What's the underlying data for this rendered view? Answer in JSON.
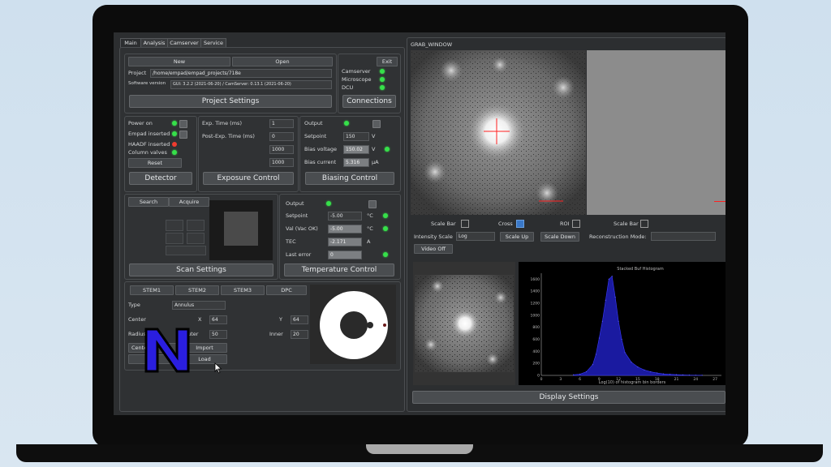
{
  "tabs": [
    "Main",
    "Analysis",
    "Camserver",
    "Service"
  ],
  "project": {
    "new_label": "New",
    "open_label": "Open",
    "project_label": "Project",
    "project_path": "/home/empad/empad_projects/718e",
    "software_label": "Software version",
    "software_value": "GUI: 3.2.2 (2021-06-20) / CamServer: 0.13.1 (2021-06-20)",
    "settings_label": "Project Settings"
  },
  "connections": {
    "exit_label": "Exit",
    "items": [
      "Camserver",
      "Microscope",
      "DCU"
    ],
    "button_label": "Connections"
  },
  "detector": {
    "items": [
      "Power on",
      "Empad inserted",
      "HAADF inserted",
      "Column valves"
    ],
    "reset_label": "Reset",
    "button_label": "Detector"
  },
  "exposure": {
    "exp_time_label": "Exp. Time (ms)",
    "exp_time_value": "1",
    "post_exp_label": "Post-Exp. Time (ms)",
    "post_exp_value": "0",
    "val3": "1000",
    "val4": "1000",
    "button_label": "Exposure Control"
  },
  "biasing": {
    "output_label": "Output",
    "setpoint_label": "Setpoint",
    "setpoint_value": "150",
    "setpoint_unit": "V",
    "voltage_label": "Bias voltage",
    "voltage_value": "150.02",
    "voltage_unit": "V",
    "current_label": "Bias current",
    "current_value": "5.316",
    "current_unit": "μA",
    "button_label": "Biasing Control"
  },
  "scan": {
    "search_label": "Search",
    "acquire_label": "Acquire",
    "button_label": "Scan Settings"
  },
  "temperature": {
    "output_label": "Output",
    "setpoint_label": "Setpoint",
    "setpoint_value": "-5.00",
    "setpoint_unit": "°C",
    "val_label": "Val (Vac OK)",
    "val_value": "-5.00",
    "val_unit": "°C",
    "tec_label": "TEC",
    "tec_value": "-2.171",
    "tec_unit": "A",
    "last_error_label": "Last error",
    "last_error_value": "0",
    "button_label": "Temperature Control"
  },
  "stem": {
    "tabs": [
      "STEM1",
      "STEM2",
      "STEM3",
      "DPC"
    ],
    "type_label": "Type",
    "type_value": "Annulus",
    "center_label": "Center",
    "x_label": "X",
    "x_value": "64",
    "y_label": "Y",
    "y_value": "64",
    "radius_label": "Radius",
    "outer_label": "Outer",
    "outer_value": "50",
    "inner_label": "Inner",
    "inner_value": "20",
    "center_button": "Center",
    "import_label": "Import",
    "load_label": "Load"
  },
  "grab": {
    "title": "GRAB_WINDOW",
    "scale_bar_label": "Scale Bar",
    "cross_label": "Cross",
    "roi_label": "ROI",
    "scale_bar2_label": "Scale Bar",
    "intensity_label": "Intensity Scale",
    "intensity_value": "Log",
    "scale_up_label": "Scale Up",
    "scale_down_label": "Scale Down",
    "recon_label": "Reconstruction Mode:",
    "video_off_label": "Video Off",
    "display_settings_label": "Display Settings"
  },
  "chart_data": {
    "type": "bar",
    "title": "Stacked Buf Histogram",
    "xlabel": "Log(10) of histogram bin borders",
    "ylabel": "",
    "xlim": [
      0,
      28
    ],
    "ylim": [
      0,
      1700
    ],
    "x_ticks": [
      0,
      3,
      6,
      9,
      12,
      15,
      18,
      21,
      24,
      27
    ],
    "y_ticks": [
      0,
      200,
      400,
      600,
      800,
      1000,
      1200,
      1400,
      1600
    ],
    "x": [
      5,
      6,
      7,
      8,
      8.5,
      9,
      9.5,
      10,
      10.5,
      11,
      11.5,
      12,
      12.5,
      13,
      14,
      15,
      16,
      17,
      18,
      19,
      20,
      21,
      22,
      23,
      24,
      25
    ],
    "values": [
      10,
      20,
      60,
      180,
      350,
      620,
      900,
      1250,
      1600,
      1650,
      1300,
      900,
      600,
      380,
      220,
      140,
      90,
      60,
      40,
      25,
      18,
      12,
      8,
      5,
      3,
      2
    ]
  },
  "colors": {
    "led_green": "#36e04a",
    "led_red": "#ef3c2f",
    "hist_blue": "#1a1aa0",
    "logo_blue": "#2a1ee0"
  }
}
